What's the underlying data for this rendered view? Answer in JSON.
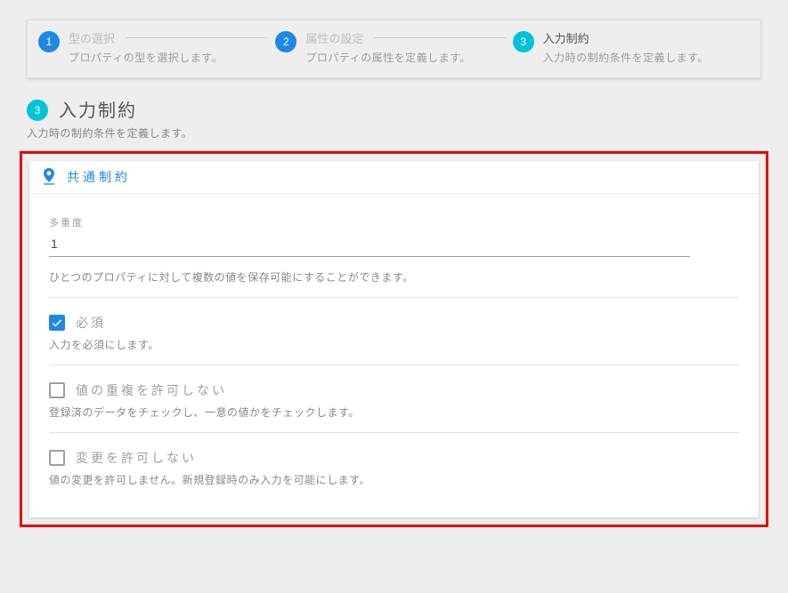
{
  "stepper": {
    "steps": [
      {
        "num": "1",
        "title": "型の選択",
        "sub": "プロパティの型を選択します。",
        "active": false
      },
      {
        "num": "2",
        "title": "属性の設定",
        "sub": "プロパティの属性を定義します。",
        "active": false
      },
      {
        "num": "3",
        "title": "入力制約",
        "sub": "入力時の制約条件を定義します。",
        "active": true
      }
    ]
  },
  "section": {
    "num": "3",
    "title": "入力制約",
    "sub": "入力時の制約条件を定義します。"
  },
  "panel": {
    "title": "共通制約",
    "multiplicity": {
      "label": "多重度",
      "value": "1",
      "help": "ひとつのプロパティに対して複数の値を保存可能にすることができます。"
    },
    "required": {
      "label": "必須",
      "help": "入力を必須にします。",
      "checked": true
    },
    "noDuplicate": {
      "label": "値の重複を許可しない",
      "help": "登録済のデータをチェックし、一意の値かをチェックします。",
      "checked": false
    },
    "noChange": {
      "label": "変更を許可しない",
      "help": "値の変更を許可しません。新規登録時のみ入力を可能にします。",
      "checked": false
    }
  }
}
